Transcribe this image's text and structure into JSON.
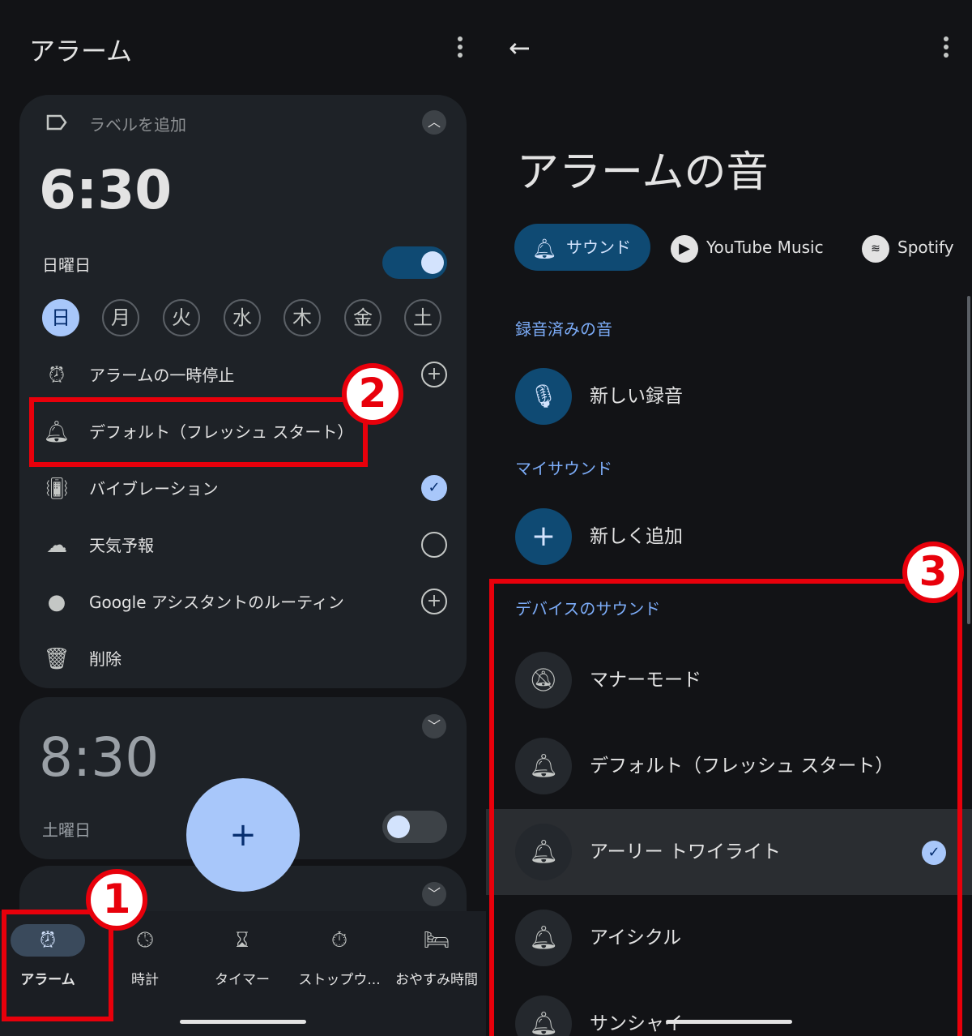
{
  "left": {
    "title": "アラーム",
    "alarm1": {
      "label_placeholder": "ラベルを追加",
      "time": "6:30",
      "repeat": "日曜日",
      "enabled": true,
      "days": [
        "日",
        "月",
        "火",
        "水",
        "木",
        "金",
        "土"
      ],
      "selected_day": "日",
      "rows": [
        {
          "label": "アラームの一時停止",
          "icon": "snooze-icon",
          "action": "add"
        },
        {
          "label": "デフォルト（フレッシュ スタート）",
          "icon": "bell-icon",
          "action": "none"
        },
        {
          "label": "バイブレーション",
          "icon": "vibration-icon",
          "action": "checked"
        },
        {
          "label": "天気予報",
          "icon": "weather-icon",
          "action": "unchecked"
        },
        {
          "label": "Google アシスタントのルーティン",
          "icon": "assistant-icon",
          "action": "add"
        },
        {
          "label": "削除",
          "icon": "trash-icon",
          "action": "none"
        }
      ]
    },
    "alarm2": {
      "time": "8:30",
      "repeat": "土曜日",
      "enabled": false
    },
    "fab": "+",
    "nav": [
      {
        "label": "アラーム",
        "icon": "alarm-icon",
        "active": true
      },
      {
        "label": "時計",
        "icon": "clock-icon",
        "active": false
      },
      {
        "label": "タイマー",
        "icon": "hourglass-icon",
        "active": false
      },
      {
        "label": "ストップウ...",
        "icon": "stopwatch-icon",
        "active": false
      },
      {
        "label": "おやすみ時間",
        "icon": "bed-icon",
        "active": false
      }
    ]
  },
  "right": {
    "title": "アラームの音",
    "tabs": [
      {
        "label": "サウンド",
        "icon": "bell-icon",
        "selected": true
      },
      {
        "label": "YouTube Music",
        "icon": "youtube-music-icon",
        "selected": false
      },
      {
        "label": "Spotify",
        "icon": "spotify-icon",
        "selected": false
      }
    ],
    "sections": {
      "recorded": "録音済みの音",
      "my_sounds": "マイサウンド",
      "device": "デバイスのサウンド"
    },
    "recorded_item": "新しい録音",
    "my_item": "新しく追加",
    "device_items": [
      {
        "label": "マナーモード",
        "icon": "bell-off-icon",
        "selected": false
      },
      {
        "label": "デフォルト（フレッシュ スタート）",
        "icon": "bell-icon",
        "selected": false
      },
      {
        "label": "アーリー トワイライト",
        "icon": "bell-icon",
        "selected": true
      },
      {
        "label": "アイシクル",
        "icon": "bell-icon",
        "selected": false
      },
      {
        "label": "サンシャイ",
        "icon": "bell-icon",
        "selected": false
      }
    ]
  },
  "annotations": [
    "1",
    "2",
    "3"
  ],
  "colors": {
    "accent": "#a8c7fa",
    "annotation_red": "#e8000b",
    "toggle_on": "#0f4a73",
    "background": "#121316",
    "card": "#1e2227"
  }
}
